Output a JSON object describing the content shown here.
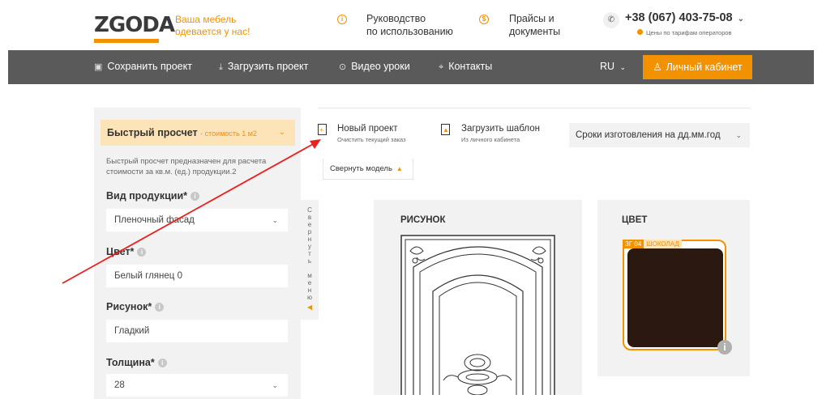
{
  "header": {
    "logo_text": "ZGODA",
    "tagline_1": "Ваша мебель",
    "tagline_2": "одевается у нас!",
    "guide_1": "Руководство",
    "guide_2": "по использованию",
    "prices_1": "Прайсы и",
    "prices_2": "документы",
    "phone": "+38 (067) 403-75-08",
    "phone_note": "Цены по тарифам операторов"
  },
  "navbar": {
    "save": "Сохранить проект",
    "load": "Загрузить проект",
    "video": "Видео уроки",
    "contacts": "Контакты",
    "lang": "RU",
    "cabinet": "Личный кабинет"
  },
  "sidebar": {
    "quick_title": "Быстрый просчет",
    "quick_sub": "- стоимость 1 м2",
    "description": "Быстрый просчет предназначен для расчета стоимости за кв.м. (ед.) продукции.2",
    "product_label": "Вид продукции*",
    "product_value": "Пленочный фасад",
    "color_label": "Цвет*",
    "color_value": "Белый глянец 0",
    "pattern_label": "Рисунок*",
    "pattern_value": "Гладкий",
    "thickness_label": "Толщина*",
    "thickness_value": "28",
    "collapse_menu": "Свернуть меню"
  },
  "toolbar": {
    "new_project": "Новый проект",
    "new_project_sub": "Очистить текущий заказ",
    "load_template": "Загрузить шаблон",
    "load_template_sub": "Из личного кабинета",
    "deadline": "Сроки изготовления на дд.мм.год",
    "collapse_model": "Свернуть модель"
  },
  "cards": {
    "pattern_title": "РИСУНОК",
    "color_title": "ЦВЕТ",
    "swatch_code": "ЗГ 04",
    "swatch_name": "ШОКОЛАД"
  },
  "colors": {
    "accent": "#f39200",
    "navbar": "#5a5a5a",
    "panel": "#f2f2f2",
    "swatch": "#2b1810"
  }
}
